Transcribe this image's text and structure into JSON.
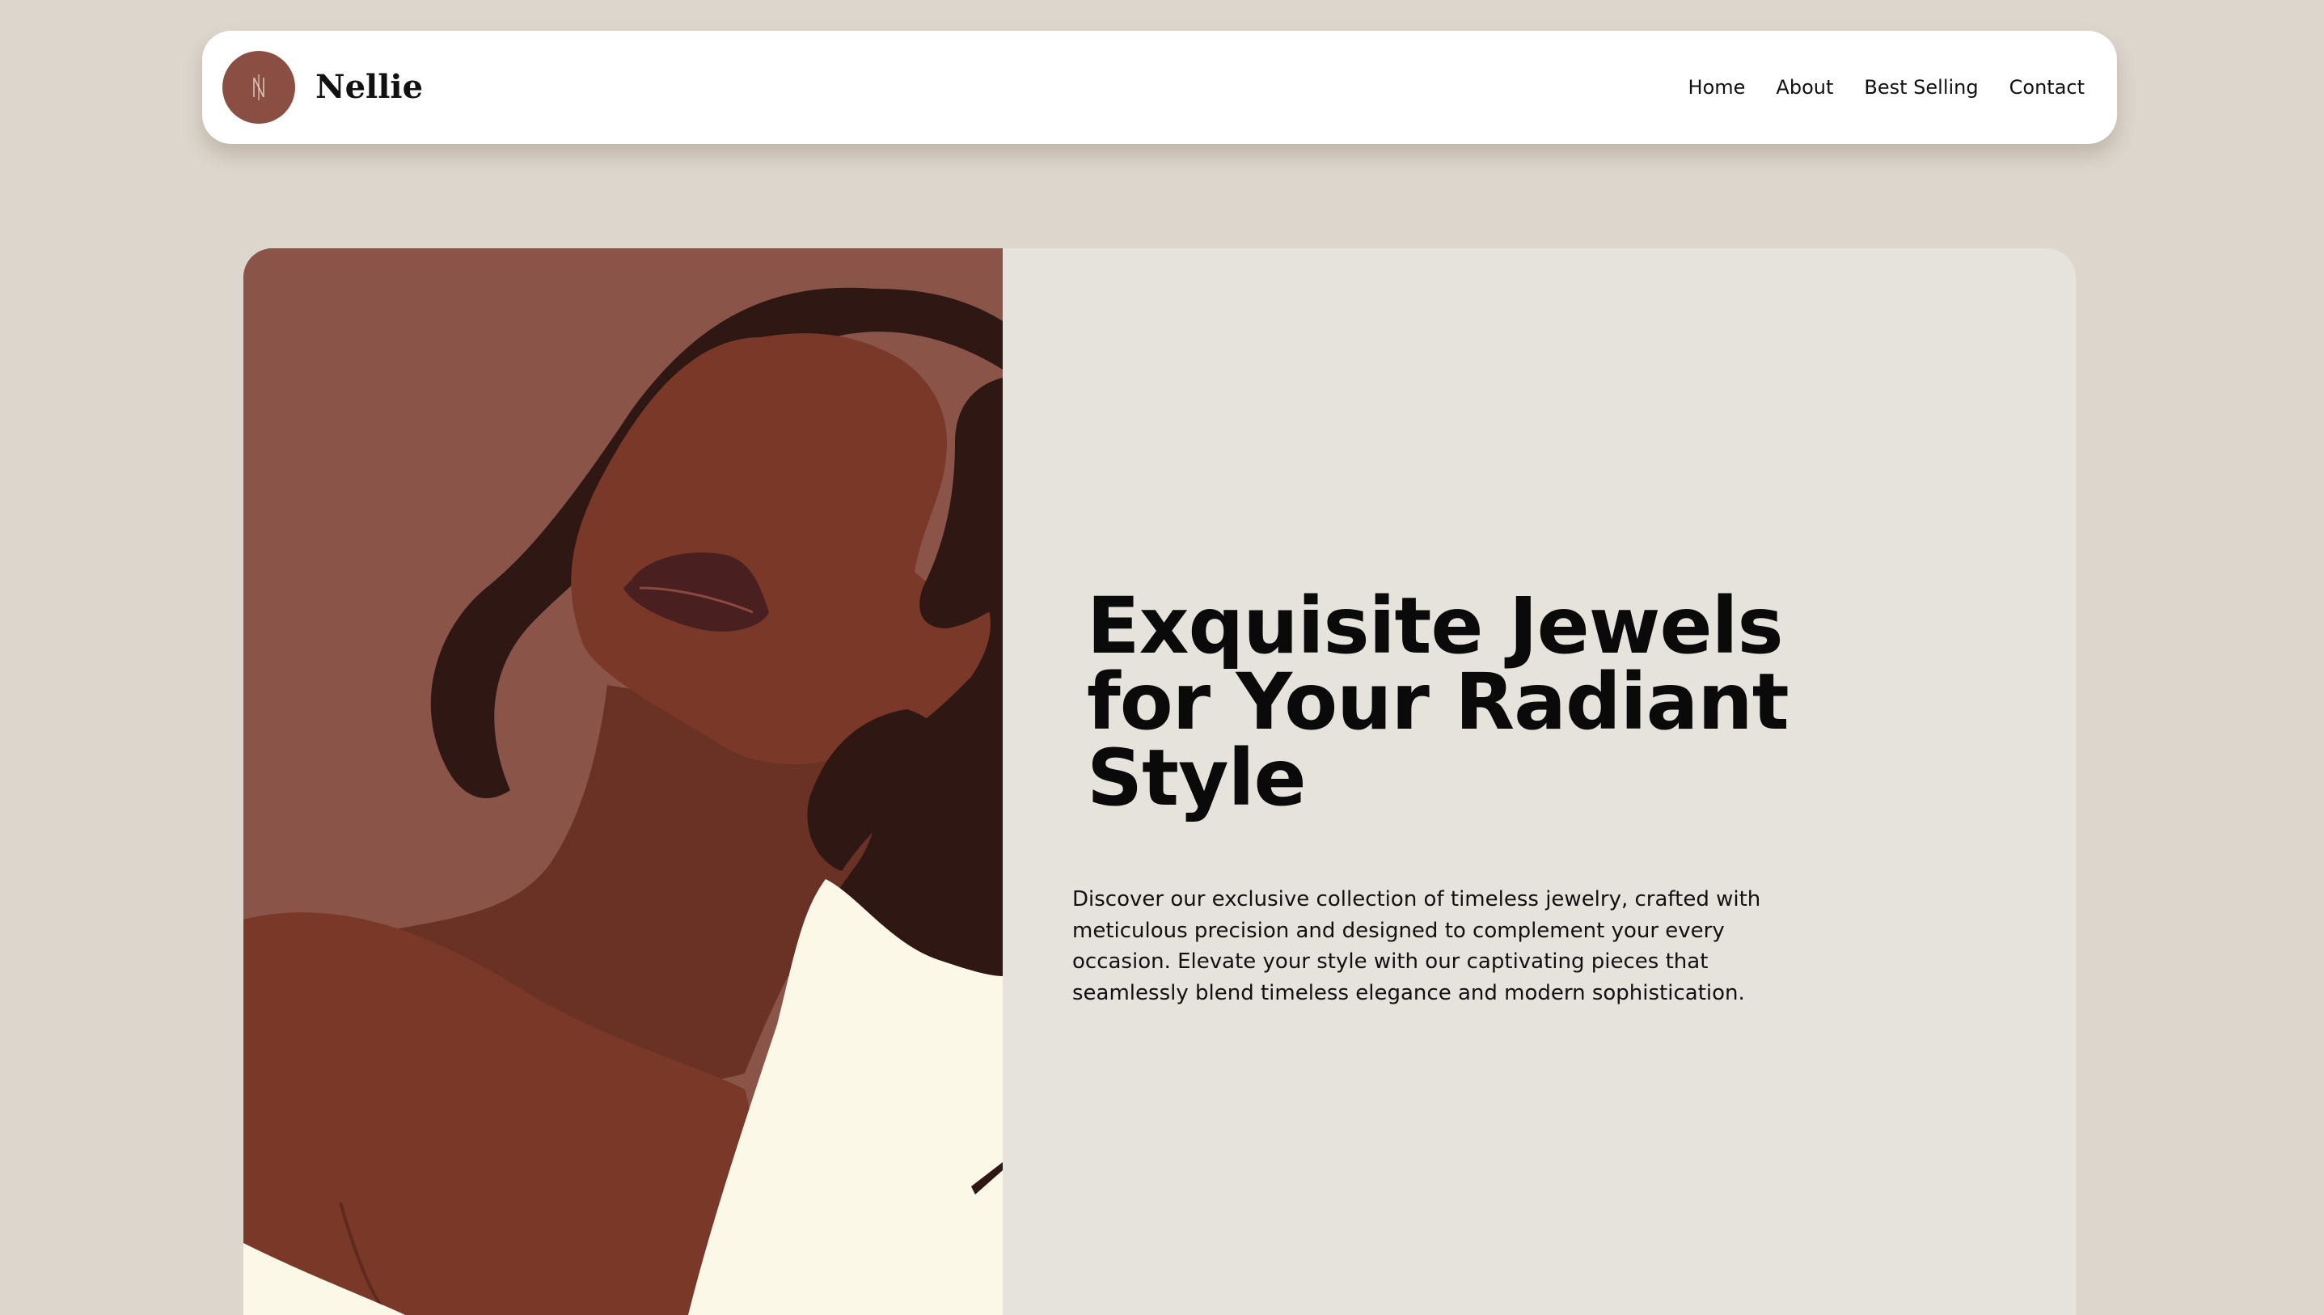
{
  "header": {
    "brand_name": "Nellie",
    "logo_icon": "needle-monogram-icon",
    "nav": [
      {
        "label": "Home"
      },
      {
        "label": "About"
      },
      {
        "label": "Best Selling"
      },
      {
        "label": "Contact"
      }
    ]
  },
  "hero": {
    "title": "Exquisite Jewels for Your Radiant Style",
    "description": "Discover our exclusive collection of timeless jewelry, crafted with meticulous precision and designed to complement your every occasion. Elevate your style with our captivating pieces that seamlessly blend timeless elegance and modern sophistication.",
    "illustration": "woman-portrait-illustration"
  },
  "colors": {
    "page_background": "#ddd6cc",
    "accent_brown": "#8a4f42",
    "hero_panel": "#e6e2dc",
    "skin": "#7a3829",
    "hair": "#2f1714",
    "shirt": "#fcf8e8"
  }
}
